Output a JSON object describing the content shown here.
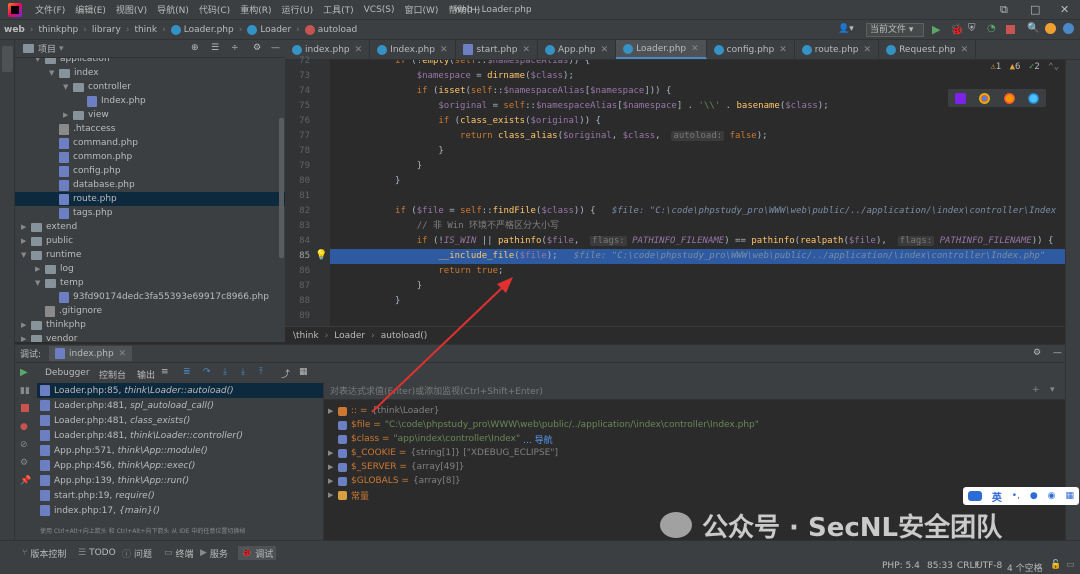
{
  "menubar": {
    "items": [
      "文件(F)",
      "编辑(E)",
      "视图(V)",
      "导航(N)",
      "代码(C)",
      "重构(R)",
      "运行(U)",
      "工具(T)",
      "VCS(S)",
      "窗口(W)",
      "帮助(H)"
    ],
    "window_title": "web - Loader.php"
  },
  "navbar": {
    "crumbs": [
      "web",
      "thinkphp",
      "library",
      "think",
      "Loader.php",
      "Loader",
      "autoload"
    ],
    "run_config": "当前文件"
  },
  "project": {
    "header": "项目",
    "tree": [
      {
        "label": "application",
        "depth": 2,
        "type": "folder",
        "open": true
      },
      {
        "label": "index",
        "depth": 3,
        "type": "folder",
        "open": true
      },
      {
        "label": "controller",
        "depth": 4,
        "type": "folder",
        "open": true
      },
      {
        "label": "Index.php",
        "depth": 5,
        "type": "php"
      },
      {
        "label": "view",
        "depth": 4,
        "type": "folder",
        "open": false
      },
      {
        "label": ".htaccess",
        "depth": 3,
        "type": "txt"
      },
      {
        "label": "command.php",
        "depth": 3,
        "type": "php"
      },
      {
        "label": "common.php",
        "depth": 3,
        "type": "php"
      },
      {
        "label": "config.php",
        "depth": 3,
        "type": "php"
      },
      {
        "label": "database.php",
        "depth": 3,
        "type": "php"
      },
      {
        "label": "route.php",
        "depth": 3,
        "type": "php",
        "selected": true
      },
      {
        "label": "tags.php",
        "depth": 3,
        "type": "php"
      },
      {
        "label": "extend",
        "depth": 1,
        "type": "folder",
        "open": false
      },
      {
        "label": "public",
        "depth": 1,
        "type": "folder",
        "open": false
      },
      {
        "label": "runtime",
        "depth": 1,
        "type": "folder",
        "open": true
      },
      {
        "label": "log",
        "depth": 2,
        "type": "folder",
        "open": false
      },
      {
        "label": "temp",
        "depth": 2,
        "type": "folder",
        "open": true
      },
      {
        "label": "93fd90174dedc3fa55393e69917c8966.php",
        "depth": 3,
        "type": "php"
      },
      {
        "label": ".gitignore",
        "depth": 2,
        "type": "txt"
      },
      {
        "label": "thinkphp",
        "depth": 1,
        "type": "folder",
        "open": false
      },
      {
        "label": "vendor",
        "depth": 1,
        "type": "folder",
        "open": false
      }
    ]
  },
  "tabs": [
    {
      "label": "index.php",
      "active": false
    },
    {
      "label": "Index.php",
      "active": false
    },
    {
      "label": "start.php",
      "active": false
    },
    {
      "label": "App.php",
      "active": false
    },
    {
      "label": "Loader.php",
      "active": true
    },
    {
      "label": "config.php",
      "active": false
    },
    {
      "label": "route.php",
      "active": false
    },
    {
      "label": "Request.php",
      "active": false
    }
  ],
  "editor": {
    "line_numbers": [
      "72",
      "73",
      "74",
      "75",
      "76",
      "77",
      "78",
      "79",
      "80",
      "81",
      "82",
      "83",
      "84",
      "85",
      "86",
      "87",
      "88",
      "89"
    ],
    "lines": [
      "            if (!empty(self::$namespaceAlias)) {",
      "                $namespace = dirname($class);",
      "                if (isset(self::$namespaceAlias[$namespace])) {",
      "                    $original = self::$namespaceAlias[$namespace] . '\\\\' . basename($class);",
      "                    if (class_exists($original)) {",
      "                        return class_alias($original, $class,  autoload: false);",
      "                    }",
      "                }",
      "            }",
      "",
      "            if ($file = self::findFile($class)) {   $file: \"C:\\code\\phpstudy_pro\\WWW\\web\\public/../application/\\index\\controller\\Index",
      "                // 非 Win 环境不严格区分大小写",
      "                if (!IS_WIN || pathinfo($file,  flags: PATHINFO_FILENAME) == pathinfo(realpath($file),  flags: PATHINFO_FILENAME)) {",
      "                    __include_file($file);   $file: \"C:\\code\\phpstudy_pro\\WWW\\web\\public/../application/\\index\\controller\\Index.php\"",
      "                    return true;",
      "                }",
      "            }",
      ""
    ],
    "highlight_line": "85",
    "inspections": {
      "warnings": "1",
      "weak": "6",
      "typos": "2"
    },
    "breadcrumb": [
      "\\think",
      "Loader",
      "autoload()"
    ]
  },
  "debug": {
    "label": "调试:",
    "session": "index.php",
    "tabs": [
      "Debugger",
      "控制台",
      "输出"
    ],
    "eval_placeholder": "对表达式求值(Enter)或添加监视(Ctrl+Shift+Enter)",
    "frames": [
      {
        "loc": "Loader.php:85,",
        "fn": "think\\Loader::autoload()"
      },
      {
        "loc": "Loader.php:481,",
        "fn": "spl_autoload_call()"
      },
      {
        "loc": "Loader.php:481,",
        "fn": "class_exists()"
      },
      {
        "loc": "Loader.php:481,",
        "fn": "think\\Loader::controller()"
      },
      {
        "loc": "App.php:571,",
        "fn": "think\\App::module()"
      },
      {
        "loc": "App.php:456,",
        "fn": "think\\App::exec()"
      },
      {
        "loc": "App.php:139,",
        "fn": "think\\App::run()"
      },
      {
        "loc": "start.php:19,",
        "fn": "require()"
      },
      {
        "loc": "index.php:17,",
        "fn": "{main}()"
      }
    ],
    "frames_hint": "使用 Ctrl+Alt+向上箭头 和 Ctrl+Alt+向下箭头 从 IDE 中的任意位置切换帧",
    "variables": [
      {
        "expand": true,
        "name": ":: =",
        "value": "{think\\Loader}",
        "kind": "gray"
      },
      {
        "expand": false,
        "name": "$file =",
        "value": "\"C:\\code\\phpstudy_pro\\WWW\\web\\public/../application/\\index\\controller\\Index.php\"",
        "kind": "str"
      },
      {
        "expand": false,
        "name": "$class =",
        "value": "\"app\\index\\controller\\Index\"",
        "extra": "... 导航",
        "kind": "str"
      },
      {
        "expand": true,
        "name": "$_COOKIE =",
        "value": "{string[1]} [\"XDEBUG_ECLIPSE\"]",
        "kind": "gray"
      },
      {
        "expand": true,
        "name": "$_SERVER =",
        "value": "{array[49]}",
        "kind": "gray"
      },
      {
        "expand": true,
        "name": "$GLOBALS =",
        "value": "{array[8]}",
        "kind": "gray"
      },
      {
        "expand": true,
        "name": "常量",
        "value": "",
        "kind": "gray"
      }
    ]
  },
  "statusbar": {
    "buttons": [
      "版本控制",
      "TODO",
      "问题",
      "终端",
      "服务",
      "调试"
    ],
    "php": "PHP: 5.4",
    "pos": "85:33",
    "eol": "CRLF",
    "enc": "UTF-8",
    "indent": "4 个空格"
  },
  "watermark": "公众号 · SecNL安全团队",
  "ime": {
    "lang": "英"
  },
  "colors": {
    "accent": "#4a88c7",
    "selection": "#2d5aa0",
    "arrow": "#e03030"
  }
}
